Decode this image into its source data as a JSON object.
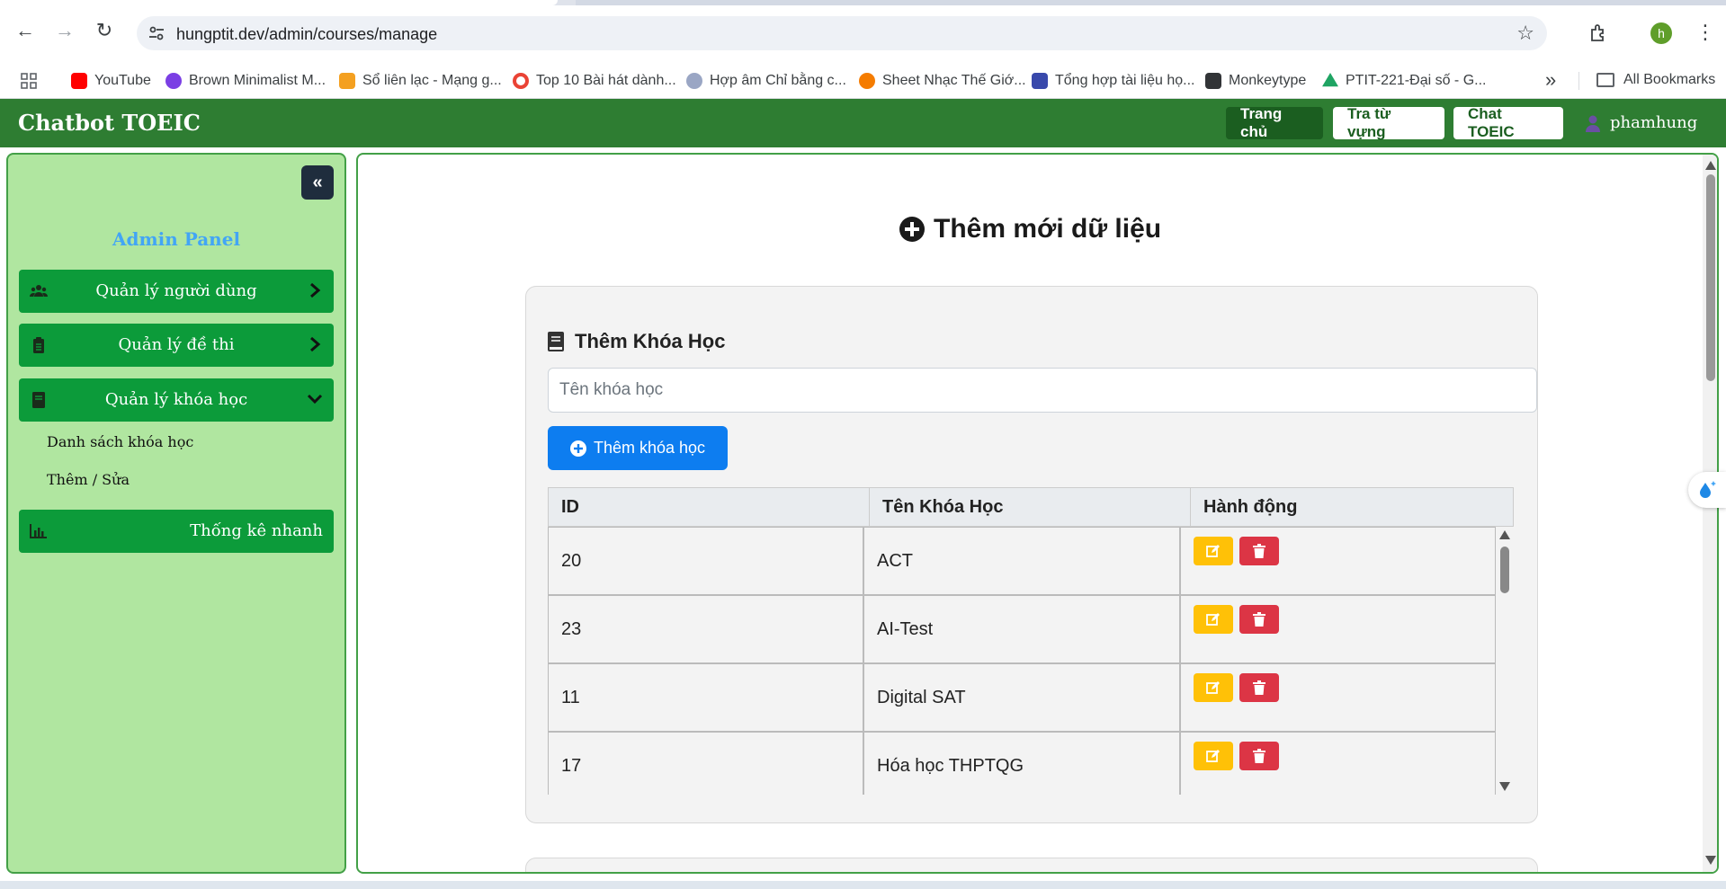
{
  "browser": {
    "url": "hungptit.dev/admin/courses/manage",
    "profile_initial": "h",
    "bookmarks": [
      {
        "label": "YouTube",
        "color": "#ff0000"
      },
      {
        "label": "Brown Minimalist M...",
        "color": "#7b3fe4"
      },
      {
        "label": "Sổ liên lạc - Mạng g...",
        "color": "#f4a020"
      },
      {
        "label": "Top 10 Bài hát dành...",
        "color": "#ea4335"
      },
      {
        "label": "Hợp âm Chỉ bằng c...",
        "color": "#9aa6c4"
      },
      {
        "label": "Sheet Nhạc Thế Giớ...",
        "color": "#f57c00"
      },
      {
        "label": "Tổng hợp tài liệu họ...",
        "color": "#3949ab"
      },
      {
        "label": "Monkeytype",
        "color": "#323437"
      },
      {
        "label": "PTIT-221-Đại số - G...",
        "color": "#1fa463"
      }
    ],
    "all_bookmarks": "All Bookmarks"
  },
  "navbar": {
    "brand": "Chatbot TOEIC",
    "links": [
      "Trang chủ",
      "Tra từ vựng",
      "Chat TOEIC"
    ],
    "username": "phamhung"
  },
  "sidebar": {
    "title": "Admin Panel",
    "collapse_icon": "double-chevron-left-icon",
    "items": [
      {
        "label": "Quản lý người dùng",
        "icon": "users-icon"
      },
      {
        "label": "Quản lý đề thi",
        "icon": "clipboard-icon"
      },
      {
        "label": "Quản lý khóa học",
        "icon": "book-icon"
      },
      {
        "label": "Thống kê nhanh",
        "icon": "chart-icon"
      }
    ],
    "sub_items": [
      "Danh sách khóa học",
      "Thêm / Sửa"
    ]
  },
  "main": {
    "title": "Thêm mới dữ liệu",
    "card_title": "Thêm Khóa Học",
    "input_placeholder": "Tên khóa học",
    "input_value": "",
    "add_button": "Thêm khóa học",
    "table": {
      "headers": [
        "ID",
        "Tên Khóa Học",
        "Hành động"
      ],
      "rows": [
        {
          "id": "20",
          "name": "ACT"
        },
        {
          "id": "23",
          "name": "AI-Test"
        },
        {
          "id": "11",
          "name": "Digital SAT"
        },
        {
          "id": "17",
          "name": "Hóa học THPTQG"
        }
      ]
    }
  },
  "colors": {
    "navbar": "#2e7d32",
    "sidebar_bg": "#b0e6a0",
    "menu_item": "#0c9b3a",
    "primary": "#0d7df0",
    "edit": "#ffc107",
    "delete": "#dc3545"
  }
}
